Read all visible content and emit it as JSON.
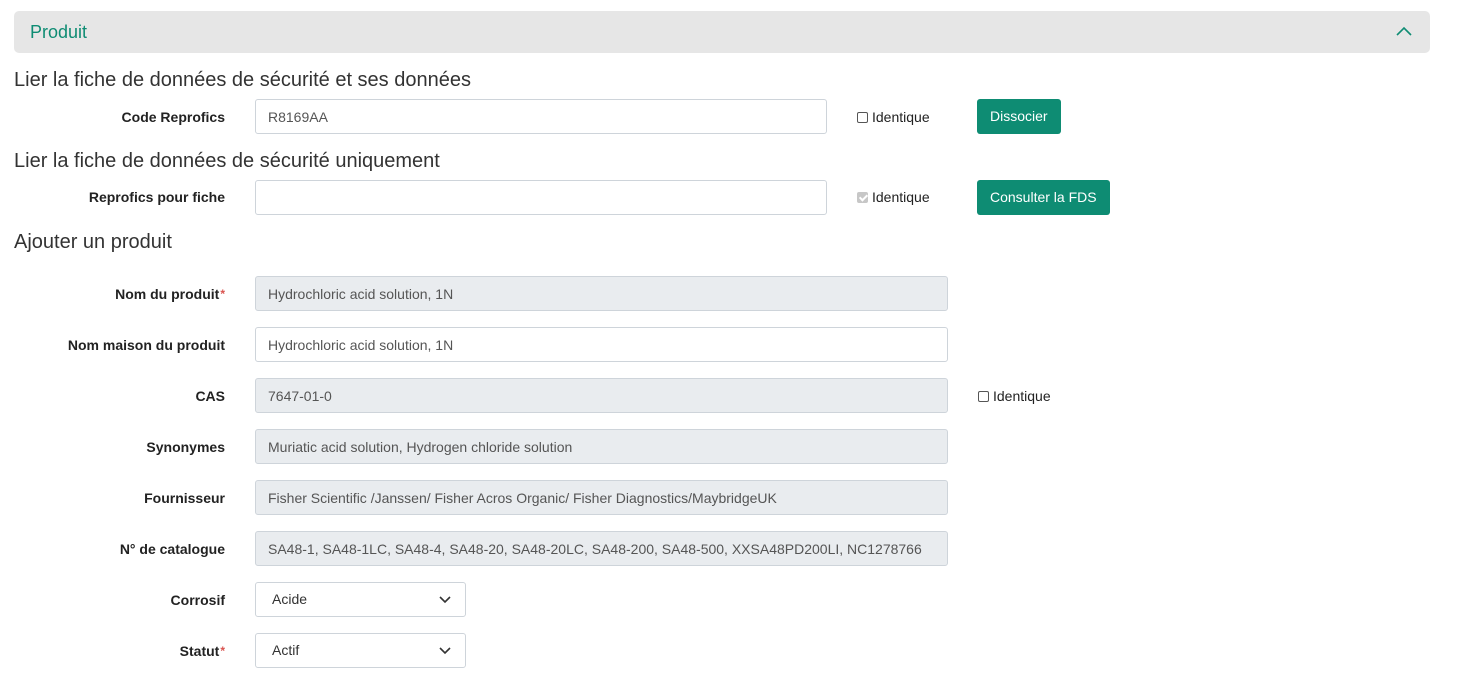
{
  "panel": {
    "title": "Produit"
  },
  "sections": {
    "link_sheet_data": "Lier la fiche de données de sécurité et ses données",
    "link_sheet_only": "Lier la fiche de données de sécurité uniquement",
    "add_product": "Ajouter un produit"
  },
  "fields": {
    "code_reprofics": {
      "label": "Code Reprofics",
      "value": "R8169AA"
    },
    "reprofics_fiche": {
      "label": "Reprofics pour fiche",
      "value": ""
    },
    "nom_produit": {
      "label": "Nom du produit",
      "required_mark": "*",
      "value": "Hydrochloric acid solution, 1N"
    },
    "nom_maison": {
      "label": "Nom maison du produit",
      "value": "Hydrochloric acid solution, 1N"
    },
    "cas": {
      "label": "CAS",
      "value": "7647-01-0"
    },
    "synonymes": {
      "label": "Synonymes",
      "value": "Muriatic acid solution, Hydrogen chloride solution"
    },
    "fournisseur": {
      "label": "Fournisseur",
      "value": "Fisher Scientific /Janssen/ Fisher Acros Organic/ Fisher Diagnostics/MaybridgeUK"
    },
    "catalogue": {
      "label": "N° de catalogue",
      "value": "SA48-1, SA48-1LC, SA48-4, SA48-20, SA48-20LC, SA48-200, SA48-500, XXSA48PD200LI, NC1278766"
    },
    "corrosif": {
      "label": "Corrosif",
      "value": "Acide"
    },
    "statut": {
      "label": "Statut",
      "required_mark": "*",
      "value": "Actif"
    }
  },
  "checkboxes": {
    "identique_code": {
      "label": "Identique",
      "checked": false
    },
    "identique_fiche": {
      "label": "Identique",
      "checked": true
    },
    "identique_cas": {
      "label": "Identique",
      "checked": false
    }
  },
  "buttons": {
    "dissocier": "Dissocier",
    "consulter": "Consulter la FDS"
  },
  "colors": {
    "accent": "#0e8c73",
    "required": "#d9534f",
    "header_bg": "#e6e6e6"
  },
  "icons": {
    "collapse": "chevron-up-icon",
    "dropdown": "chevron-down-icon"
  }
}
